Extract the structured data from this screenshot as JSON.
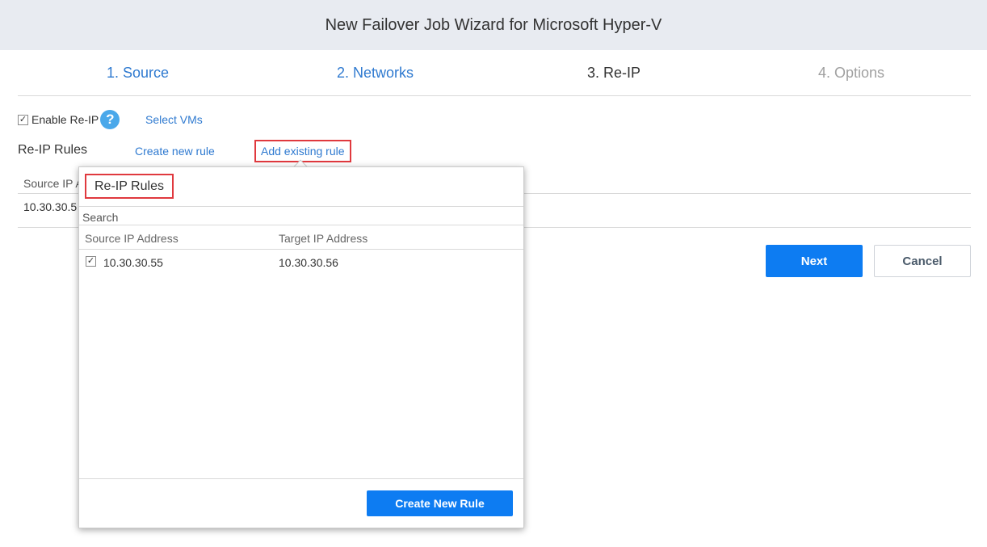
{
  "window": {
    "title": "New Failover Job Wizard for Microsoft Hyper-V"
  },
  "steps": [
    {
      "label": "1. Source",
      "state": "done"
    },
    {
      "label": "2. Networks",
      "state": "done"
    },
    {
      "label": "3. Re-IP",
      "state": "current"
    },
    {
      "label": "4. Options",
      "state": "future"
    }
  ],
  "reip": {
    "enable_checked": true,
    "enable_label": "Enable Re-IP",
    "help_glyph": "?",
    "select_vms_label": "Select VMs",
    "rules_heading": "Re-IP Rules",
    "create_new_rule_link": "Create new rule",
    "add_existing_rule_link": "Add existing rule"
  },
  "background_table": {
    "header_partial": "Source IP A",
    "row_partial": "10.30.30.5"
  },
  "buttons": {
    "next": "Next",
    "cancel": "Cancel"
  },
  "popup": {
    "title": "Re-IP Rules",
    "search_placeholder": "Search",
    "columns": [
      "Source IP Address",
      "Target IP Address"
    ],
    "rows": [
      {
        "checked": true,
        "source": "10.30.30.55",
        "target": "10.30.30.56"
      }
    ],
    "create_button": "Create New Rule"
  },
  "colors": {
    "accent": "#0d7cf2",
    "link": "#2f7ad0",
    "highlight_border": "#e0393e",
    "titlebar_bg": "#e8ebf1",
    "help_icon": "#4aa8ea"
  },
  "icons": {
    "help": "question-circle-icon",
    "check": "checkmark-icon"
  }
}
